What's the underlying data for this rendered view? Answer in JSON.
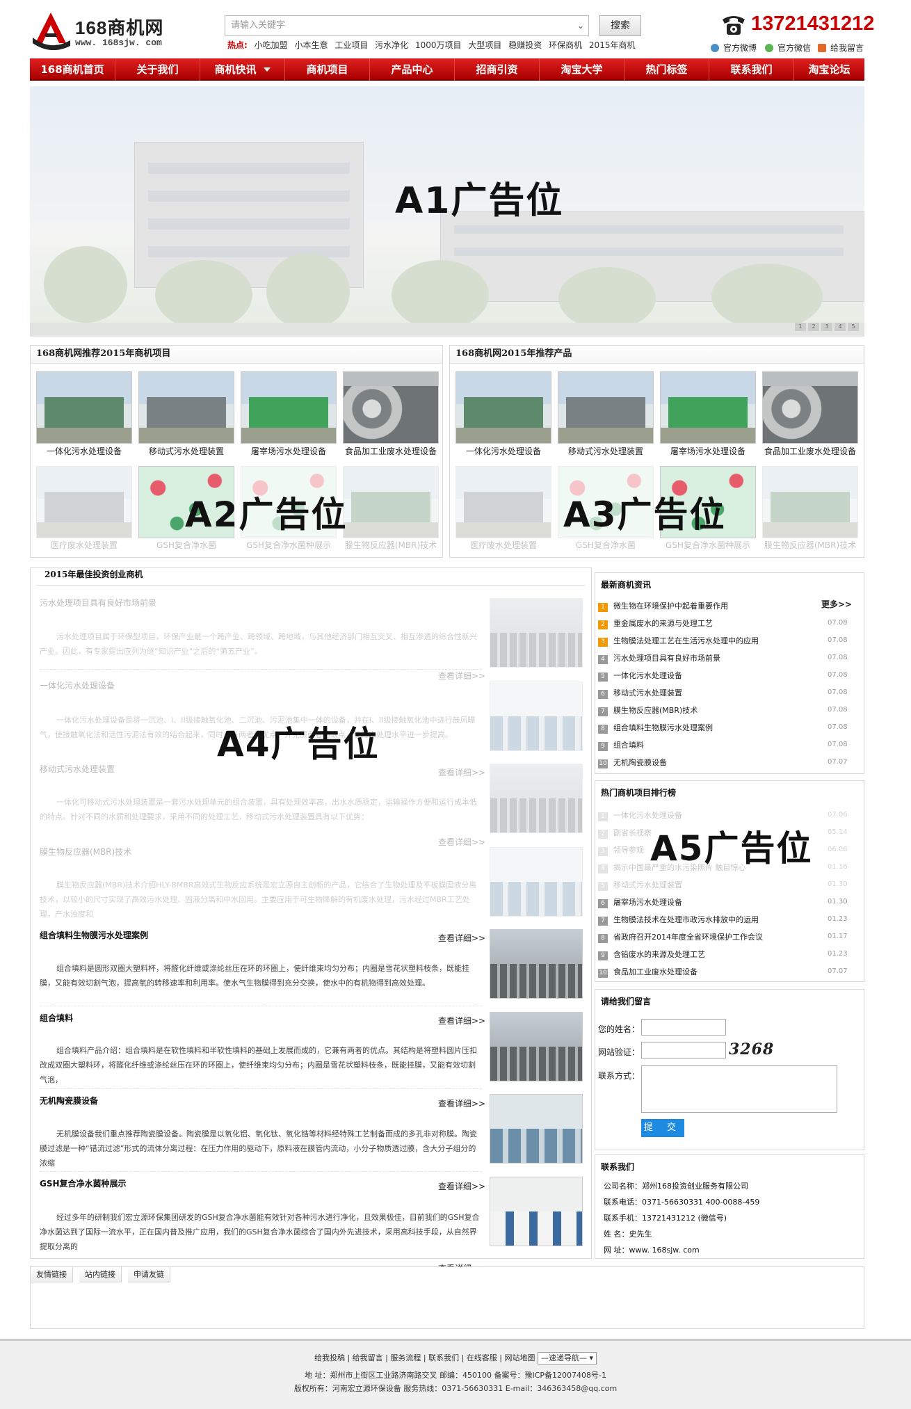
{
  "header": {
    "logo_main": "168商机网",
    "logo_sub": "www. 168sjw. com",
    "search_placeholder": "请输入关键字",
    "search_button": "搜索",
    "hot_label": "热点:",
    "hot_items": [
      "小吃加盟",
      "小本生意",
      "工业项目",
      "污水净化",
      "1000万项目",
      "大型项目",
      "稳赚投资",
      "环保商机",
      "2015年商机"
    ],
    "phone": "13721431212",
    "social": [
      "官方微博",
      "官方微信",
      "给我留言"
    ]
  },
  "nav": [
    "168商机首页",
    "关于我们",
    "商机快讯",
    "商机项目",
    "产品中心",
    "招商引资",
    "淘宝大学",
    "热门标签",
    "联系我们",
    "淘宝论坛"
  ],
  "banner": {
    "ad_label": "A1广告位",
    "dots": [
      "1",
      "2",
      "3",
      "4",
      "5"
    ]
  },
  "projects": {
    "title": "168商机网推荐2015年商机项目",
    "row1": [
      "一体化污水处理设备",
      "移动式污水处理装置",
      "屠宰场污水处理设备",
      "食品加工业废水处理设备"
    ],
    "row2": [
      "医疗废水处理装置",
      "GSH复合净水菌",
      "GSH复合净水菌种展示",
      "膜生物反应器(MBR)技术"
    ],
    "ad_label": "A2广告位"
  },
  "products": {
    "title": "168商机网2015年推荐产品",
    "row1": [
      "一体化污水处理设备",
      "移动式污水处理装置",
      "屠宰场污水处理设备",
      "食品加工业废水处理设备"
    ],
    "row2": [
      "医疗废水处理装置",
      "GSH复合净水菌",
      "GSH复合净水菌种展示",
      "膜生物反应器(MBR)技术"
    ],
    "ad_label": "A3广告位"
  },
  "articles": {
    "title": "2015年最佳投资创业商机",
    "ad_label": "A4广告位",
    "more": "查看详细>>",
    "items": [
      {
        "title": "污水处理项目具有良好市场前景",
        "text": "污水处理项目属于环保型项目，环保产业是一个跨产业、跨领域、跨地域，与其他经济部门相互交叉、相互渗透的综合性新兴产业。因此，有专家提出应列为继“知识产业”之后的“第五产业”。"
      },
      {
        "title": "一体化污水处理设备",
        "text": "一体化污水处理设备是将一沉池、I、II级接触氧化池、二沉池、污泥池集中一体的设备，并在I、II级接触氧化池中进行鼓风曝气，使接触氧化法和活性污泥法有效的结合起来，同时具备两者的优点，并克服两者的缺点，使污水处理水平进一步提高。"
      },
      {
        "title": "移动式污水处理装置",
        "text": "一体化可移动式污水处理装置是一套污水处理单元的组合装置，具有处理效率高，出水水质稳定，运输操作方便和运行成本低的特点。针对不同的水质和处理要求，采用不同的处理工艺，移动式污水处理装置具有以下优势："
      },
      {
        "title": "膜生物反应器(MBR)技术",
        "text": "膜生物反应器(MBR)技术介绍HLY-BMBR高效式生物反应系统是宏立源自主创新的产品，它结合了生物处理及平板膜固液分离技术，以较小的尺寸实现了高效污水处理、固液分离和中水回用。主要应用于可生物降解的有机废水处理，污水经过MBR工艺处理，产水浊度和"
      },
      {
        "title": "组合填料生物膜污水处理案例",
        "text": "组合填料是圆形双圈大塑料杯，将醛化纤维或涤纶丝压在环的环圈上，使纤维束均匀分布；内圈是雪花状塑料枝条，既能挂膜，又能有效切割气泡，提高氧的转移速率和利用率。使水气生物膜得到充分交换，使水中的有机物得到高效处理。"
      },
      {
        "title": "组合填料",
        "text": "组合填料产品介绍：组合填料是在软性填料和半软性填料的基础上发展而成的，它兼有两者的优点。其结构是将塑料圆片压扣改成双圈大塑料环，将醛化纤维或涤纶丝压在环的环圈上，使纤维束均匀分布；内圈是雪花状塑料枝条，既能挂膜，又能有效切割气泡，"
      },
      {
        "title": "无机陶瓷膜设备",
        "text": "无机膜设备我们重点推荐陶瓷膜设备。陶瓷膜是以氧化铝、氧化钛、氧化锆等材料经特殊工艺制备而成的多孔非对称膜。陶瓷膜过滤是一种“错流过滤”形式的流体分离过程：在压力作用的驱动下，原料液在膜管内流动，小分子物质透过膜，含大分子组分的浓缩"
      },
      {
        "title": "GSH复合净水菌种展示",
        "text": "经过多年的研制我们宏立源环保集团研发的GSH复合净水菌能有效针对各种污水进行净化，且效果极佳，目前我们的GSH复合净水菌达到了国际一流水平，正在国内普及推广应用，我们的GSH复合净水菌综合了国内外先进技术，采用高科技手段，从自然界提取分离的"
      }
    ]
  },
  "latest_news": {
    "title": "最新商机资讯",
    "more": "更多>>",
    "items": [
      {
        "num": "1",
        "text": "微生物在环境保护中起着重要作用",
        "date": ""
      },
      {
        "num": "2",
        "text": "重金属废水的来源与处理工艺",
        "date": "07.08"
      },
      {
        "num": "3",
        "text": "生物膜法处理工艺在生活污水处理中的应用",
        "date": "07.08"
      },
      {
        "num": "4",
        "text": "污水处理项目具有良好市场前景",
        "date": "07.08"
      },
      {
        "num": "5",
        "text": "一体化污水处理设备",
        "date": "07.08"
      },
      {
        "num": "6",
        "text": "移动式污水处理装置",
        "date": "07.08"
      },
      {
        "num": "7",
        "text": "膜生物反应器(MBR)技术",
        "date": "07.08"
      },
      {
        "num": "8",
        "text": "组合填料生物膜污水处理案例",
        "date": "07.08"
      },
      {
        "num": "9",
        "text": "组合填料",
        "date": "07.08"
      },
      {
        "num": "10",
        "text": "无机陶瓷膜设备",
        "date": "07.07"
      }
    ]
  },
  "hot_rank": {
    "title": "热门商机项目排行榜",
    "ad_label": "A5广告位",
    "items": [
      {
        "num": "1",
        "text": "一体化污水处理设备",
        "date": "07.06"
      },
      {
        "num": "2",
        "text": "副省长视察",
        "date": "05.14"
      },
      {
        "num": "3",
        "text": "领导参观",
        "date": "06.06"
      },
      {
        "num": "4",
        "text": "揭示中国最严重的水污染照片 触目惊心",
        "date": "01.16"
      },
      {
        "num": "5",
        "text": "移动式污水处理装置",
        "date": "01.30"
      },
      {
        "num": "6",
        "text": "屠宰场污水处理设备",
        "date": "01.30"
      },
      {
        "num": "7",
        "text": "生物膜法技术在处理市政污水排放中的运用",
        "date": "01.23"
      },
      {
        "num": "8",
        "text": "省政府召开2014年度全省环境保护工作会议",
        "date": "01.17"
      },
      {
        "num": "9",
        "text": "含铅废水的来源及处理工艺",
        "date": "01.23"
      },
      {
        "num": "10",
        "text": "食品加工业废水处理设备",
        "date": "07.07"
      }
    ]
  },
  "message": {
    "title": "请给我们留言",
    "name_label": "您的姓名：",
    "verify_label": "网站验证：",
    "captcha": "3268",
    "contact_label": "联系方式：",
    "submit": "提 交"
  },
  "contact": {
    "title": "联系我们",
    "lines": [
      "公司名称：郑州168投资创业服务有限公司",
      "联系电话：0371-56630331 400-0088-459",
      "联系手机：13721431212 (微信号)",
      "姓  名：史先生",
      "网  址：www. 168sjw. com"
    ]
  },
  "friend_links": {
    "tabs": [
      "友情链接",
      "站内链接",
      "申请友链"
    ]
  },
  "footer": {
    "links": "给我投稿 | 给我留言 | 服务流程 | 联系我们 | 在线客服 | 网站地图",
    "nav_select": "—速递导航—",
    "line2": "地  址：郑州市上街区工业路济南路交叉  邮编：450100  备案号：豫ICP备12007408号-1",
    "line3": "版权所有：河南宏立源环保设备  服务热线：0371-56630331  E-mail：346363458@qq.com"
  },
  "colors": {
    "brand_red": "#c00000",
    "accent_blue": "#1e8ae0",
    "badge_orange": "#f39800"
  }
}
